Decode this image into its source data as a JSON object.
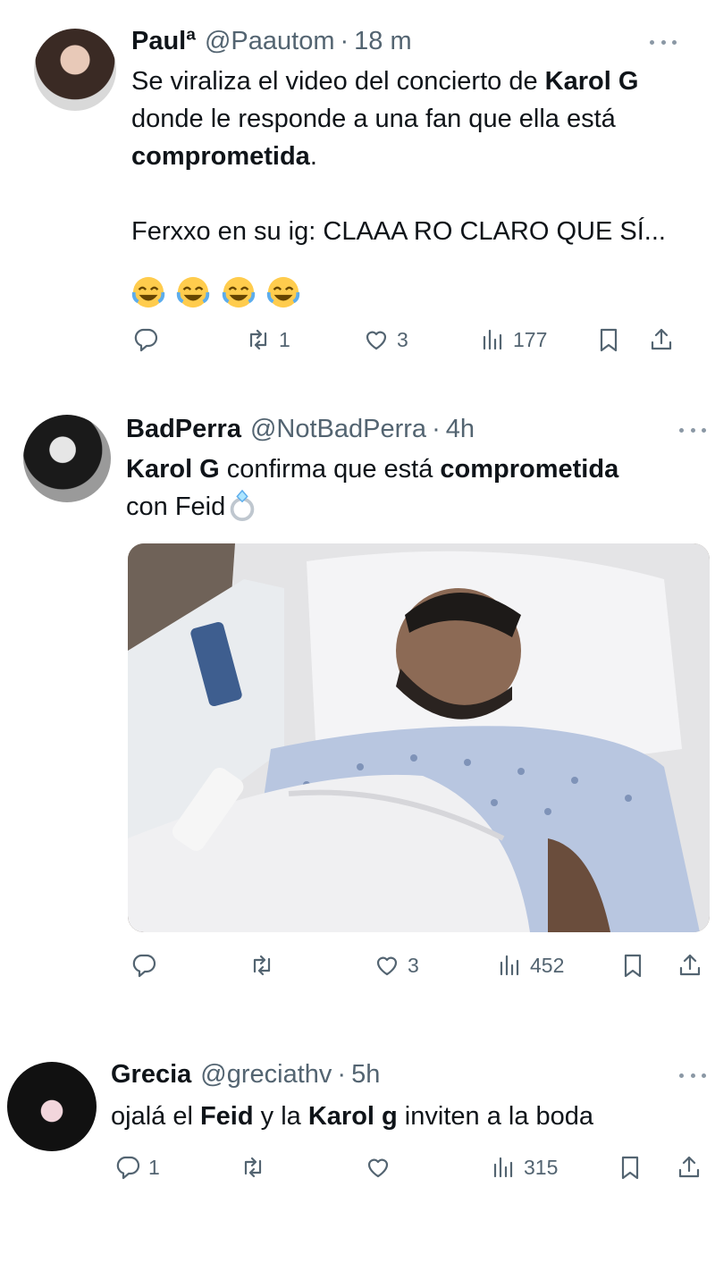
{
  "tweets": [
    {
      "name": "Paulª",
      "handle": "@Paautom",
      "separator": "·",
      "time": "18 m",
      "text_lines": [
        [
          {
            "t": "Se viraliza el video del concierto de "
          },
          {
            "t": "Karol G",
            "b": true
          }
        ],
        [
          {
            "t": "donde le responde a una fan que ella está"
          }
        ],
        [
          {
            "t": "comprometida",
            "b": true
          },
          {
            "t": "."
          }
        ],
        [],
        [
          {
            "t": "Ferxxo en su ig: CLAAA RO CLARO QUE SÍ..."
          }
        ]
      ],
      "emojis": [
        "laughing-emoji",
        "laughing-emoji",
        "laughing-emoji",
        "laughing-emoji"
      ],
      "stats": {
        "reply": "",
        "retweet": "1",
        "like": "3",
        "views": "177"
      }
    },
    {
      "name": "BadPerra",
      "handle": "@NotBadPerra",
      "separator": "·",
      "time": "4h",
      "text_lines": [
        [
          {
            "t": "Karol G",
            "b": true
          },
          {
            "t": " confirma que está "
          },
          {
            "t": "comprometida",
            "b": true
          }
        ],
        [
          {
            "t": "con Feid"
          }
        ]
      ],
      "trailing_icon": "ring-emoji",
      "media": "hospital-photo",
      "stats": {
        "reply": "",
        "retweet": "",
        "like": "3",
        "views": "452"
      }
    },
    {
      "name": "Grecia",
      "handle": "@greciathv",
      "separator": "·",
      "time": "5h",
      "text_lines": [
        [
          {
            "t": "ojalá el "
          },
          {
            "t": "Feid",
            "b": true
          },
          {
            "t": " y la "
          },
          {
            "t": "Karol g",
            "b": true
          },
          {
            "t": " inviten a la boda"
          }
        ]
      ],
      "stats": {
        "reply": "1",
        "retweet": "",
        "like": "",
        "views": "315"
      }
    }
  ],
  "colors": {
    "text": "#0f1419",
    "secondary": "#536471",
    "background": "#ffffff"
  },
  "icons": [
    "reply-icon",
    "retweet-icon",
    "like-icon",
    "views-icon",
    "bookmark-icon",
    "share-icon",
    "more-icon"
  ]
}
